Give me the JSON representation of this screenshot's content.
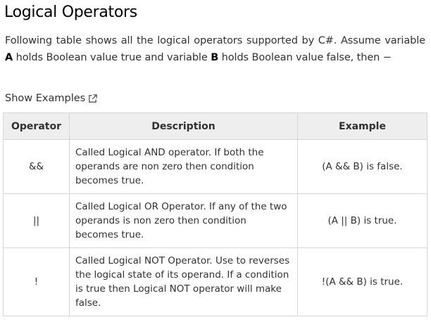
{
  "heading": "Logical Operators",
  "intro": {
    "part1": "Following table shows all the logical operators supported by C#. Assume variable ",
    "var_a": "A",
    "part2": " holds Boolean value true and variable ",
    "var_b": "B",
    "part3": " holds Boolean value false, then −"
  },
  "show_examples": {
    "label": "Show Examples",
    "icon": "external-link-icon"
  },
  "table": {
    "headers": [
      "Operator",
      "Description",
      "Example"
    ],
    "rows": [
      {
        "operator": "&&",
        "description": "Called Logical AND operator. If both the operands are non zero then condition becomes true.",
        "example": "(A && B) is false."
      },
      {
        "operator": "||",
        "description": "Called Logical OR Operator. If any of the two operands is non zero then condition becomes true.",
        "example": "(A || B) is true."
      },
      {
        "operator": "!",
        "description": "Called Logical NOT Operator. Use to reverses the logical state of its operand. If a condition is true then Logical NOT operator will make false.",
        "example": "!(A && B) is true."
      }
    ]
  },
  "colors": {
    "header_bg": "#eeeeee",
    "border": "#d6d6d6",
    "text": "#313131"
  }
}
